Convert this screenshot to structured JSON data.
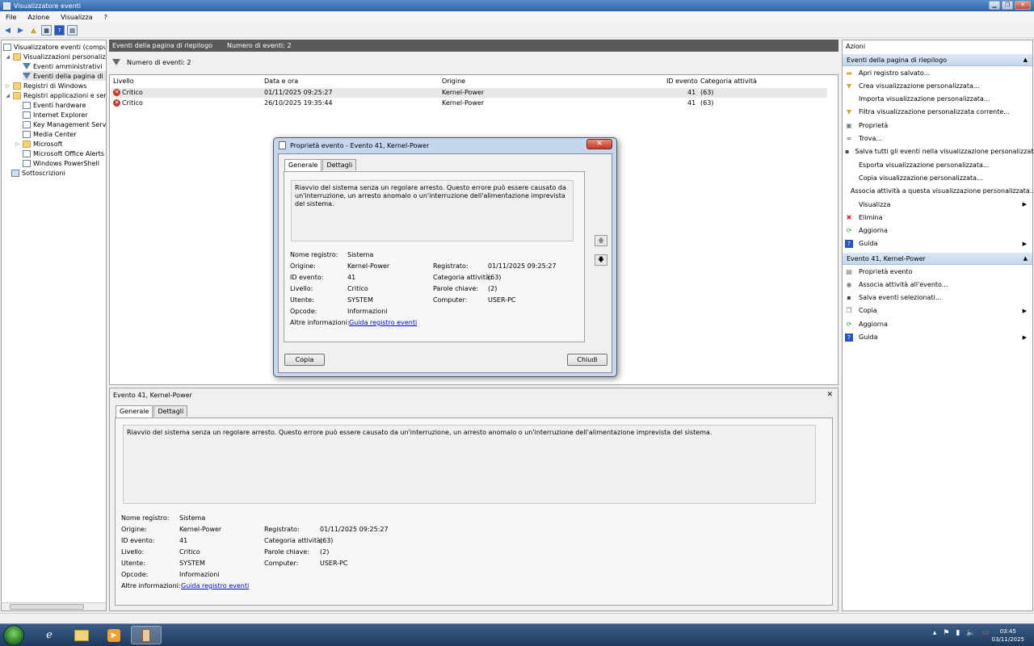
{
  "window": {
    "title": "Visualizzatore eventi"
  },
  "menu": [
    "File",
    "Azione",
    "Visualizza",
    "?"
  ],
  "tree": {
    "items": [
      {
        "label": "Visualizzatore eventi (computer"
      },
      {
        "label": "Visualizzazioni personalizzate"
      },
      {
        "label": "Eventi amministrativi"
      },
      {
        "label": "Eventi della pagina di riepi"
      },
      {
        "label": "Registri di Windows"
      },
      {
        "label": "Registri applicazioni e servizi"
      },
      {
        "label": "Eventi hardware"
      },
      {
        "label": "Internet Explorer"
      },
      {
        "label": "Key Management Service"
      },
      {
        "label": "Media Center"
      },
      {
        "label": "Microsoft"
      },
      {
        "label": "Microsoft Office Alerts"
      },
      {
        "label": "Windows PowerShell"
      },
      {
        "label": "Sottoscrizioni"
      }
    ]
  },
  "center": {
    "header_title": "Eventi della pagina di riepilogo",
    "header_count": "Numero di eventi: 2",
    "filter_text": "Numero di eventi: 2",
    "columns": [
      "Livello",
      "Data e ora",
      "Origine",
      "ID evento",
      "Categoria attività"
    ],
    "rows": [
      {
        "level": "Critico",
        "date": "01/11/2025 09:25:27",
        "source": "Kernel-Power",
        "id": "41",
        "category": "(63)"
      },
      {
        "level": "Critico",
        "date": "26/10/2025 19:35:44",
        "source": "Kernel-Power",
        "id": "41",
        "category": "(63)"
      }
    ]
  },
  "details": {
    "pane_title": "Evento 41, Kernel-Power",
    "close_glyph": "✕",
    "tab_general": "Generale",
    "tab_details": "Dettagli",
    "description": "Riavvio del sistema senza un regolare arresto. Questo errore può essere causato da un'interruzione, un arresto anomalo o un'interruzione dell'alimentazione imprevista del sistema.",
    "labels": {
      "log_name": "Nome registro:",
      "source": "Origine:",
      "event_id": "ID evento:",
      "level": "Livello:",
      "user": "Utente:",
      "opcode": "Opcode:",
      "more_info": "Altre informazioni:",
      "logged": "Registrato:",
      "task_category": "Categoria attività:",
      "keywords": "Parole chiave:",
      "computer": "Computer:"
    },
    "values": {
      "log_name": "Sistema",
      "source": "Kernel-Power",
      "event_id": "41",
      "level": "Critico",
      "user": "SYSTEM",
      "opcode": "Informazioni",
      "more_info_link": "Guida registro eventi",
      "logged": "01/11/2025 09:25:27",
      "task_category": "(63)",
      "keywords": "(2)",
      "computer": "USER-PC"
    }
  },
  "dialog": {
    "title": "Proprietà evento - Evento 41, Kernel-Power",
    "close_glyph": "✕",
    "copy_button": "Copia",
    "close_button": "Chiudi"
  },
  "actions": {
    "header": "Azioni",
    "section1_title": "Eventi della pagina di riepilogo",
    "section1": [
      {
        "label": "Apri registro salvato...",
        "icon": "folder-open-icon"
      },
      {
        "label": "Crea visualizzazione personalizzata...",
        "icon": "filter-icon"
      },
      {
        "label": "Importa visualizzazione personalizzata...",
        "icon": ""
      },
      {
        "label": "Filtra visualizzazione personalizzata corrente...",
        "icon": "filter-icon"
      },
      {
        "label": "Proprietà",
        "icon": "properties-icon"
      },
      {
        "label": "Trova...",
        "icon": "binoculars-icon"
      },
      {
        "label": "Salva tutti gli eventi nella visualizzazione personalizzata...",
        "icon": "save-icon"
      },
      {
        "label": "Esporta visualizzazione personalizzata...",
        "icon": ""
      },
      {
        "label": "Copia visualizzazione personalizzata...",
        "icon": ""
      },
      {
        "label": "Associa attività a questa visualizzazione personalizzata...",
        "icon": ""
      },
      {
        "label": "Visualizza",
        "icon": "",
        "submenu": true
      },
      {
        "label": "Elimina",
        "icon": "delete-icon"
      },
      {
        "label": "Aggiorna",
        "icon": "refresh-icon"
      },
      {
        "label": "Guida",
        "icon": "help-icon",
        "submenu": true
      }
    ],
    "section2_title": "Evento 41, Kernel-Power",
    "section2": [
      {
        "label": "Proprietà evento",
        "icon": "event-properties-icon"
      },
      {
        "label": "Associa attività all'evento...",
        "icon": "task-icon"
      },
      {
        "label": "Salva eventi selezionati...",
        "icon": "save-icon"
      },
      {
        "label": "Copia",
        "icon": "copy-icon",
        "submenu": true
      },
      {
        "label": "Aggiorna",
        "icon": "refresh-icon"
      },
      {
        "label": "Guida",
        "icon": "help-icon",
        "submenu": true
      }
    ]
  },
  "taskbar": {
    "time": "03:45",
    "date": "03/11/2025"
  }
}
